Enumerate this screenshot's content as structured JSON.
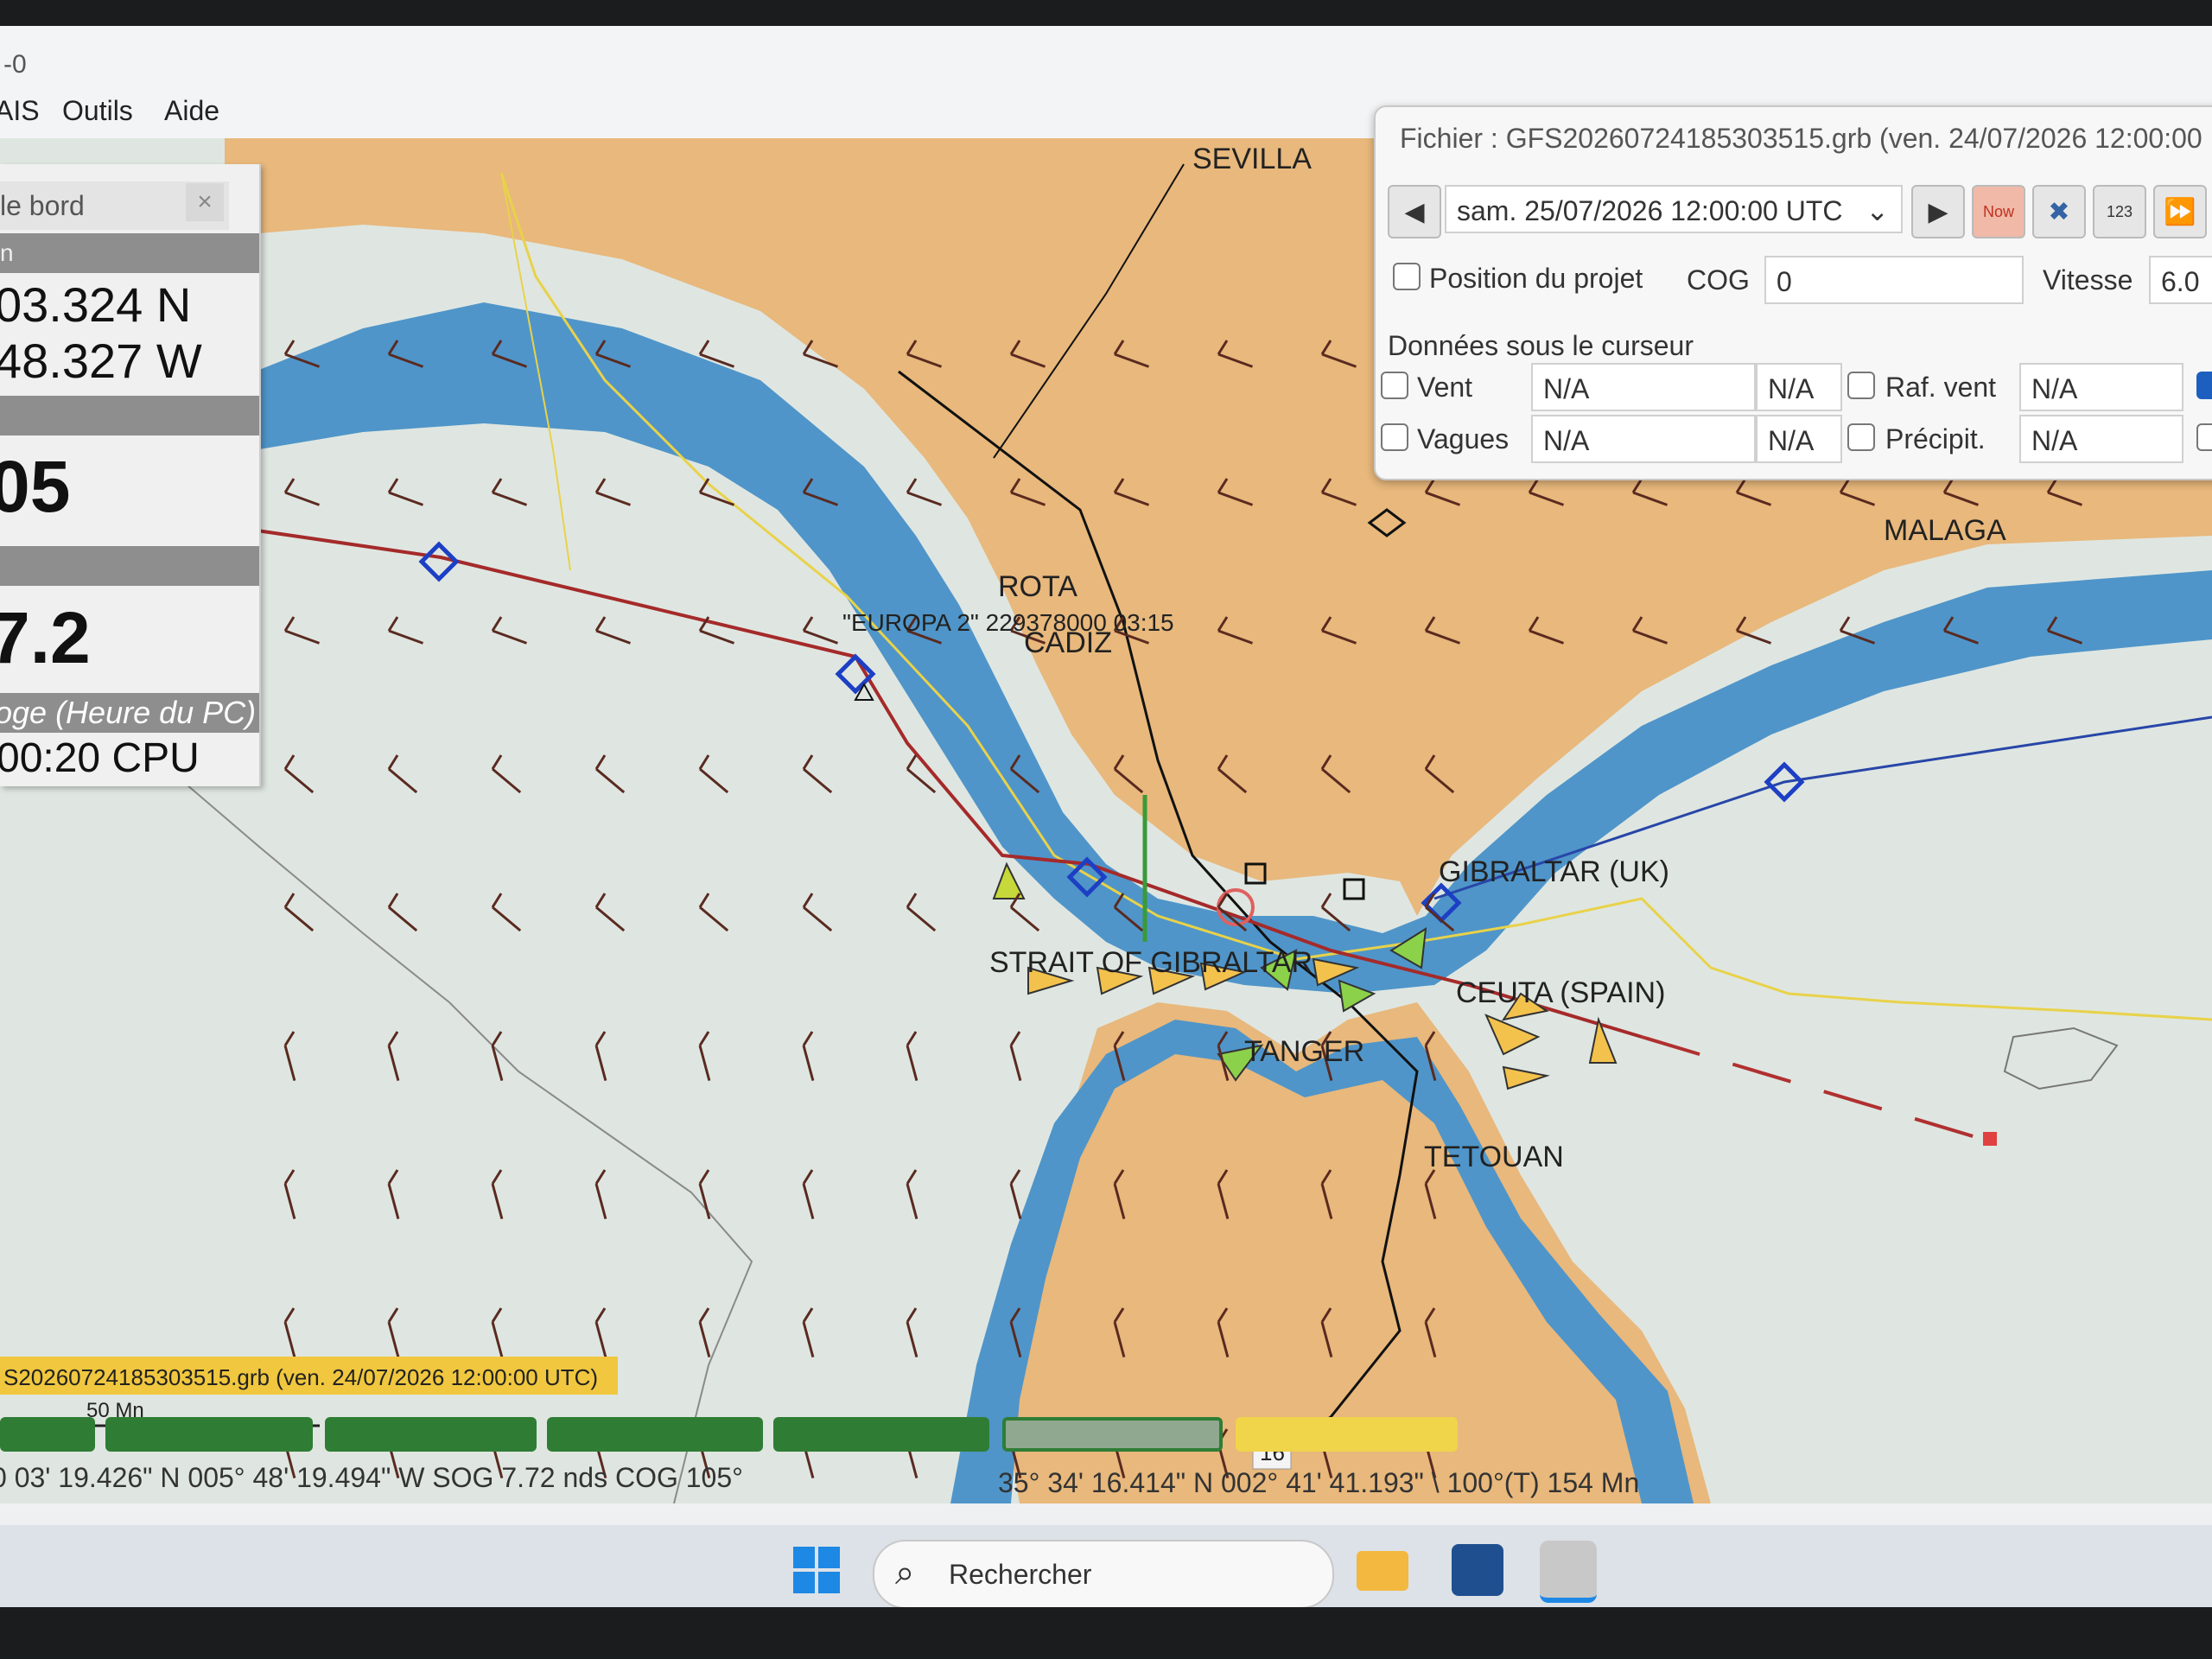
{
  "window": {
    "title": "-0"
  },
  "menu": {
    "items": [
      "AIS",
      "Outils",
      "Aide"
    ]
  },
  "dashboard": {
    "header": "le bord",
    "close_glyph": "×",
    "section_label": "n",
    "lat": "03.324 N",
    "lon": "48.327 W",
    "big_value": "05",
    "speed": "7.2",
    "clock_label": "oge (Heure du PC)",
    "clock_value": "00:20 CPU"
  },
  "grib_panel": {
    "file_label": "Fichier : GFS20260724185303515.grb (ven. 24/07/2026 12:00:00",
    "datetime": "sam. 25/07/2026 12:00:00 UTC",
    "now_label": "Now",
    "num_label": "123",
    "position_label": "Position du projet",
    "cog_label": "COG",
    "cog_value": "0",
    "speed_label": "Vitesse",
    "speed_value": "6.0",
    "cursor_section": "Données sous le curseur",
    "rows": [
      {
        "label": "Vent",
        "value": "N/A",
        "value2": "N/A",
        "label2": "Raf. vent",
        "value3": "N/A"
      },
      {
        "label": "Vagues",
        "value": "N/A",
        "value2": "N/A",
        "label2": "Précipit.",
        "value3": "N/A"
      }
    ]
  },
  "map": {
    "labels": {
      "sevilla": "SEVILLA",
      "rota": "ROTA",
      "cadiz": "CADIZ",
      "malaga": "MALAGA",
      "gibraltar": "GIBRALTAR (UK)",
      "strait": "STRAIT OF GIBRALTAR",
      "ceuta": "CEUTA (SPAIN)",
      "tanger": "TANGER",
      "tetouan": "TETOUAN",
      "ais_target": "\"EUROPA 2\" 229378000 03:15"
    },
    "grib_banner": "S20260724185303515.grb (ven. 24/07/2026 12:00:00 UTC)",
    "scale_label": "50 Mn",
    "route_badge": "16"
  },
  "status": {
    "position": "0 03' 19.426\" N   005° 48' 19.494\" W   SOG 7.72 nds   COG 105°",
    "cursor": "35° 34' 16.414\" N   002° 41' 41.193\" \\ 100°(T)  154 Mn"
  },
  "taskbar": {
    "search_placeholder": "Rechercher"
  },
  "colors": {
    "land": "#e8b87c",
    "shallow": "#4f95c9",
    "deep": "#dde4e0",
    "route": "#a52a2a",
    "track": "#2846a8"
  }
}
